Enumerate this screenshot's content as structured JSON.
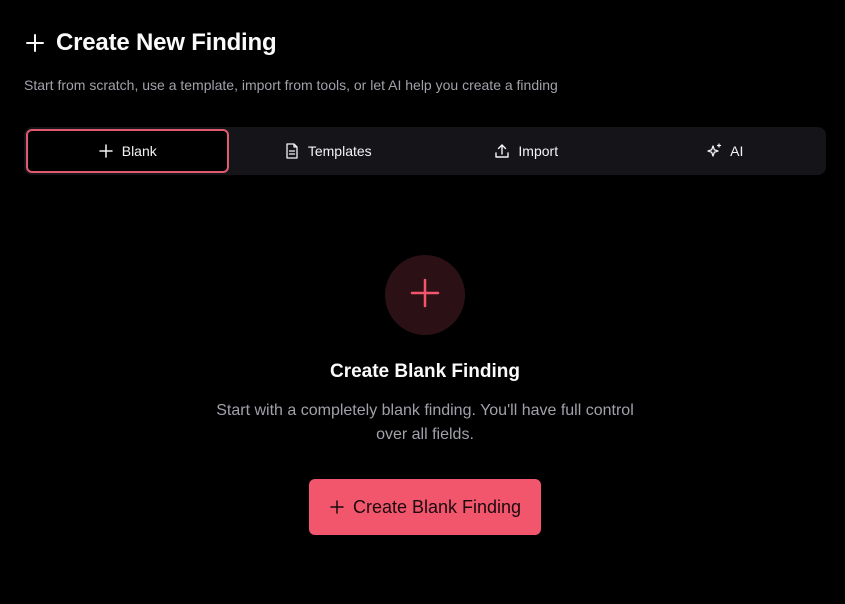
{
  "header": {
    "title": "Create New Finding",
    "icon": "plus-icon",
    "subtitle": "Start from scratch, use a template, import from tools, or let AI help you create a finding"
  },
  "tabs": [
    {
      "label": "Blank",
      "icon": "plus-icon",
      "active": true
    },
    {
      "label": "Templates",
      "icon": "document-icon",
      "active": false
    },
    {
      "label": "Import",
      "icon": "upload-icon",
      "active": false
    },
    {
      "label": "AI",
      "icon": "sparkles-icon",
      "active": false
    }
  ],
  "empty_state": {
    "icon": "plus-icon",
    "title": "Create Blank Finding",
    "description": "Start with a completely blank finding. You'll have full control over all fields.",
    "button_label": "Create Blank Finding"
  },
  "colors": {
    "accent": "#f2566d",
    "active_border": "#e25a6f",
    "background": "#000000",
    "tab_bar": "#141419",
    "muted_text": "#a1a1aa"
  }
}
